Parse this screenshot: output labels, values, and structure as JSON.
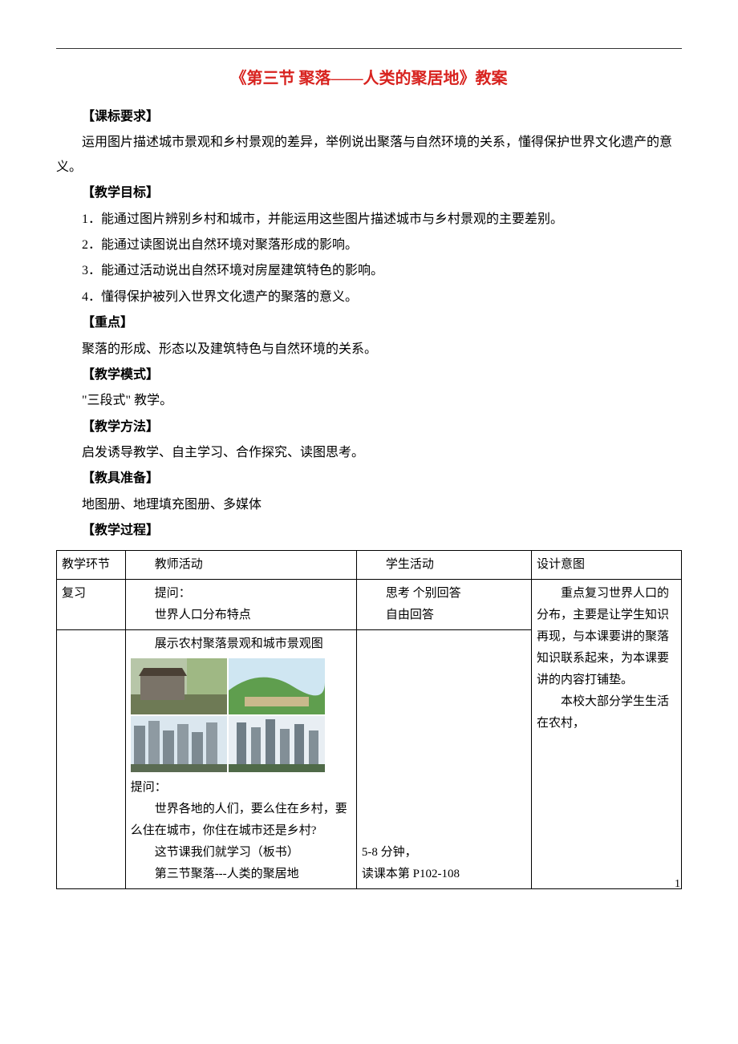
{
  "title": "《第三节  聚落——人类的聚居地》教案",
  "sections": {
    "kbyq_h": "【课标要求】",
    "kbyq_p": "运用图片描述城市景观和乡村景观的差异，举例说出聚落与自然环境的关系，懂得保护世界文化遗产的意义。",
    "jxmb_h": "【教学目标】",
    "jxmb_1": "1．能通过图片辨别乡村和城市，并能运用这些图片描述城市与乡村景观的主要差别。",
    "jxmb_2": "2．能通过读图说出自然环境对聚落形成的影响。",
    "jxmb_3": "3．能通过活动说出自然环境对房屋建筑特色的影响。",
    "jxmb_4": "4．懂得保护被列入世界文化遗产的聚落的意义。",
    "zd_h": "【重点】",
    "zd_p": "聚落的形成、形态以及建筑特色与自然环境的关系。",
    "jxms_h": "【教学模式】",
    "jxms_p": "\"三段式\" 教学。",
    "jxff_h": "【教学方法】",
    "jxff_p": "启发诱导教学、自主学习、合作探究、读图思考。",
    "jjzb_h": "【教具准备】",
    "jjzb_p": "地图册、地理填充图册、多媒体",
    "jxgc_h": "【教学过程】"
  },
  "table": {
    "head": {
      "c1": "教学环节",
      "c2": "教师活动",
      "c3": "学生活动",
      "c4": "设计意图"
    },
    "r1": {
      "c1": "复习",
      "c2a": "提问：",
      "c2b": "世界人口分布特点",
      "c3a": "思考    个别回答",
      "c3b": "自由回答",
      "c4": ""
    },
    "r2": {
      "c1": "",
      "c2_a": "展示农村聚落景观和城市景观图",
      "c2_b": "提问：",
      "c2_c": "世界各地的人们，要么住在乡村，要么住在城市，你住在城市还是乡村?",
      "c2_d": "这节课我们就学习（板书）",
      "c2_e": "第三节聚落---人类的聚居地",
      "c3_a": "5-8 分钟，",
      "c3_b": "读课本第 P102-108",
      "c4_a": "重点复习世界人口的分布，主要是让学生知识再现，与本课要讲的聚落知识联系起来，为本课要讲的内容打铺垫。",
      "c4_b": "本校大部分学生生活在农村，"
    }
  },
  "page_num": "1",
  "images": {
    "rural1": "rural-stone-house",
    "rural2": "rural-green-hills",
    "city1": "city-highrise-wide",
    "city2": "city-skyscrapers"
  }
}
